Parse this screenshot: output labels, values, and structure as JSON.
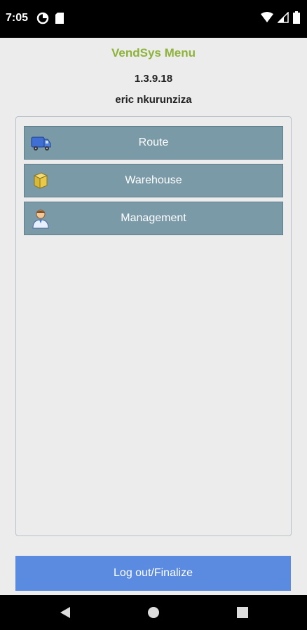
{
  "status_bar": {
    "time": "7:05",
    "icons": [
      "data-saver-icon",
      "sd-card-icon",
      "wifi-icon",
      "signal-icon",
      "battery-icon"
    ]
  },
  "header": {
    "title": "VendSys Menu",
    "version": "1.3.9.18",
    "user": "eric nkurunziza",
    "title_color": "#8db33a"
  },
  "menu": {
    "items": [
      {
        "label": "Route",
        "icon": "truck-icon"
      },
      {
        "label": "Warehouse",
        "icon": "box-icon"
      },
      {
        "label": "Management",
        "icon": "manager-icon"
      }
    ],
    "item_color": "#7a9aa8"
  },
  "footer": {
    "logout_label": "Log out/Finalize",
    "logout_color": "#5b8be0"
  },
  "nav": {
    "icons": [
      "back-icon",
      "home-icon",
      "recents-icon"
    ]
  }
}
